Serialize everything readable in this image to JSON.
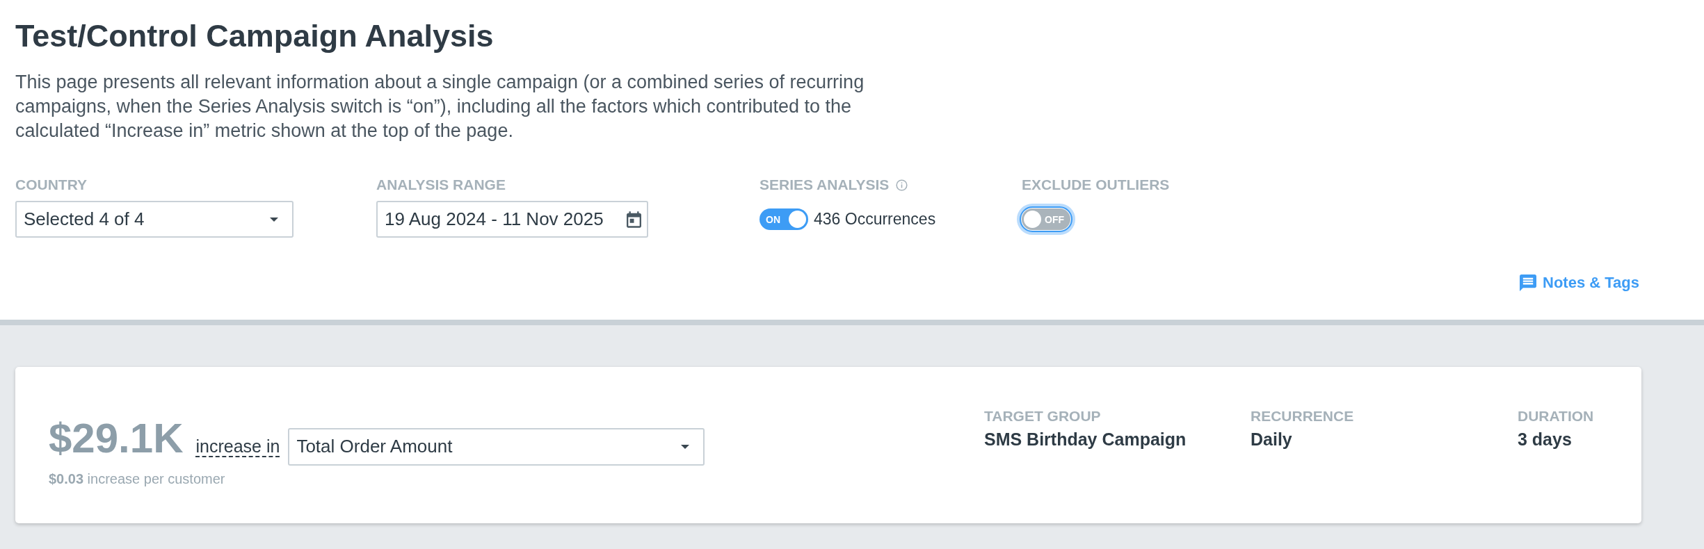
{
  "header": {
    "title": "Test/Control Campaign Analysis",
    "description": "This page presents all relevant information about a single campaign (or a combined series of recurring campaigns, when the Series Analysis switch is “on”), including all the factors which contributed to the calculated “Increase in” metric shown at the top of the page."
  },
  "filters": [
    {
      "kind": "dropdown",
      "label": "COUNTRY",
      "value": "Selected 4 of 4"
    },
    {
      "kind": "date_range",
      "label": "ANALYSIS RANGE",
      "value": "19 Aug 2024 - 11 Nov 2025"
    },
    {
      "kind": "toggle",
      "label": "SERIES ANALYSIS",
      "info": true,
      "on": true,
      "focused": false,
      "switch_text": "ON",
      "detail": "436 Occurrences"
    },
    {
      "kind": "toggle",
      "label": "EXCLUDE OUTLIERS",
      "info": false,
      "on": false,
      "focused": true,
      "switch_text": "OFF"
    }
  ],
  "notes_link": {
    "label": "Notes & Tags"
  },
  "summary": {
    "value": "$29.1K",
    "value_caption": "increase in",
    "metric": "Total Order Amount",
    "per_customer": "**$0.03** increase per customer",
    "facts": [
      {
        "label": "TARGET GROUP",
        "value": "SMS Birthday Campaign"
      },
      {
        "label": "RECURRENCE",
        "value": "Daily"
      },
      {
        "label": "DURATION",
        "value": "3 days"
      }
    ]
  }
}
